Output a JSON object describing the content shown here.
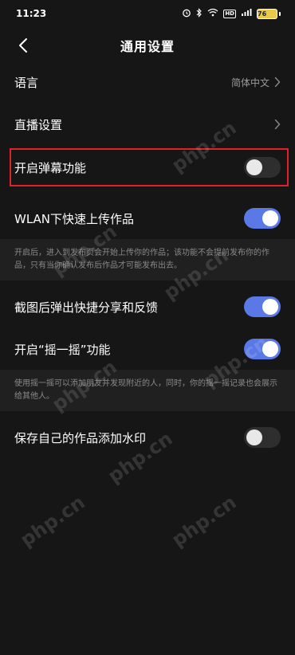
{
  "status_bar": {
    "time": "11:23",
    "hd": "HD",
    "signal": "5G",
    "battery": "76"
  },
  "nav": {
    "title": "通用设置"
  },
  "rows": {
    "language": {
      "label": "语言",
      "value": "简体中文"
    },
    "live": {
      "label": "直播设置"
    },
    "danmaku": {
      "label": "开启弹幕功能",
      "toggle": "off"
    },
    "wlan": {
      "label": "WLAN下快速上传作品",
      "toggle": "on"
    },
    "wlan_desc": "开启后，进入到发布页会开始上传你的作品；该功能不会提前发布你的作品，只有当你确认发布后作品才可能发布出去。",
    "screenshot": {
      "label": "截图后弹出快捷分享和反馈",
      "toggle": "on"
    },
    "shake": {
      "label": "开启“摇一摇”功能",
      "toggle": "on"
    },
    "shake_desc": "使用摇一摇可以添加朋友并发现附近的人，同时，你的摇一摇记录也会展示给其他人。",
    "watermark": {
      "label": "保存自己的作品添加水印",
      "toggle": "off"
    }
  },
  "colors": {
    "background": "#161616",
    "toggle_on": "#5b79e6",
    "highlight": "#e0202a"
  },
  "watermark_text": "php.cn"
}
